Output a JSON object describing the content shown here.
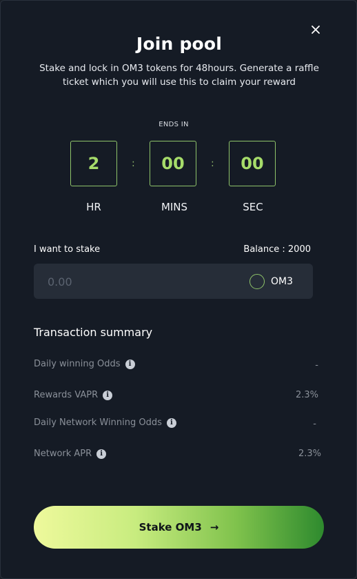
{
  "modal": {
    "title": "Join pool",
    "subtitle": "Stake and lock in OM3 tokens for 48hours. Generate a raffle ticket which you will use this to claim your reward"
  },
  "countdown": {
    "ends_label": "ENDS IN",
    "hours": "2",
    "minutes": "00",
    "seconds": "00",
    "hours_label": "HR",
    "minutes_label": "MINS",
    "seconds_label": "SEC",
    "separator": ":"
  },
  "stake": {
    "label": "I want to stake",
    "balance": "Balance : 2000",
    "input_placeholder": "0.00",
    "input_value": "",
    "token": "OM3"
  },
  "summary": {
    "title": "Transaction summary",
    "rows": [
      {
        "label": "Daily winning Odds",
        "value": "-"
      },
      {
        "label": "Rewards VAPR",
        "value": "2.3%"
      },
      {
        "label": "Daily Network Winning Odds",
        "value": "-"
      },
      {
        "label": "Network APR",
        "value": "2.3%"
      }
    ]
  },
  "cta": {
    "label": "Stake OM3",
    "arrow": "→"
  },
  "icons": {
    "close": "close-icon",
    "info": "info-icon",
    "token": "token-circle-icon",
    "arrow": "arrow-right-icon"
  },
  "colors": {
    "background": "#151b25",
    "accent": "#a6dc6a",
    "input_bg": "#262d38",
    "muted_text": "#8a9099"
  }
}
